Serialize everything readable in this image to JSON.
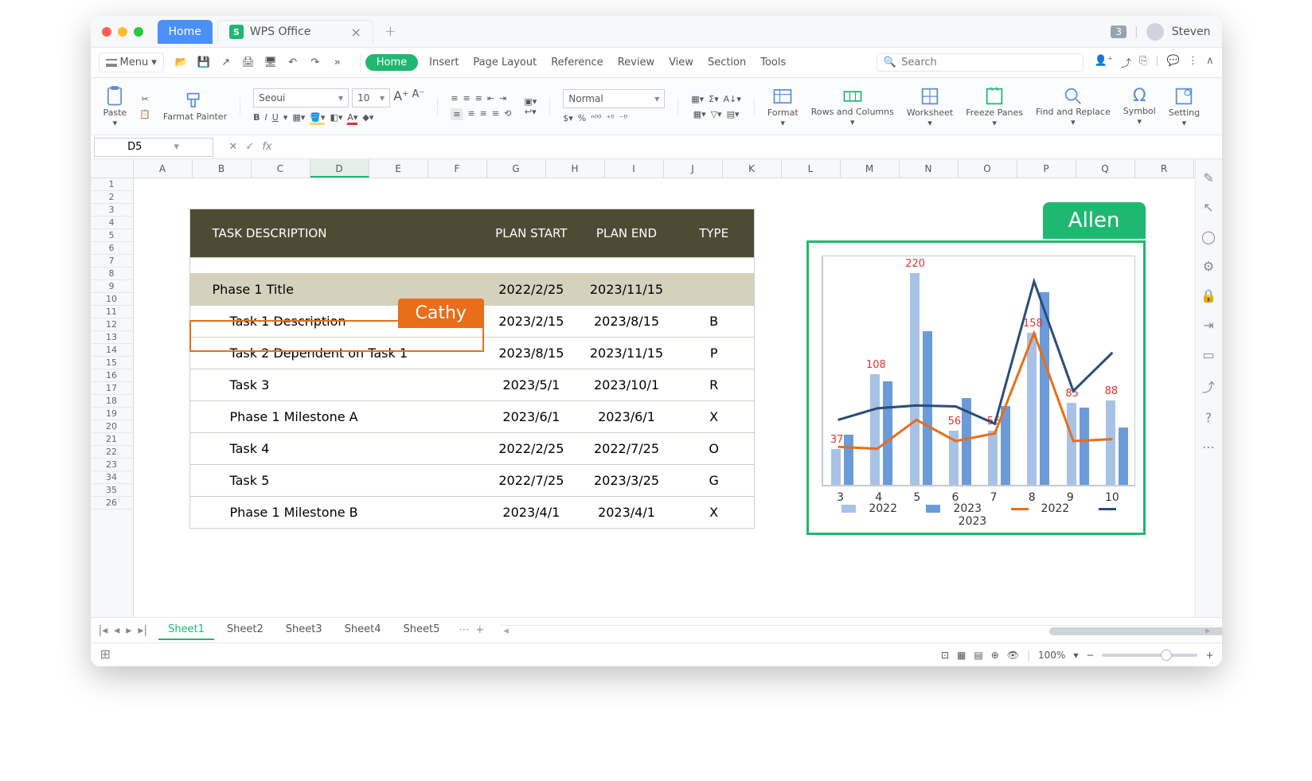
{
  "titlebar": {
    "home_tab": "Home",
    "app_tab": "WPS Office",
    "badge": "3",
    "user": "Steven"
  },
  "menubar": {
    "menu_btn": "Menu",
    "home_pill": "Home",
    "items": [
      "Insert",
      "Page Layout",
      "Reference",
      "Review",
      "View",
      "Section",
      "Tools"
    ],
    "search_placeholder": "Search"
  },
  "ribbon": {
    "paste": "Paste",
    "format_painter": "Farmat Painter",
    "font_name": "Seoui",
    "font_size": "10",
    "number_fmt": "Normal",
    "format": "Format",
    "rows_cols": "Rows and Columns",
    "worksheet": "Worksheet",
    "freeze": "Freeze Panes",
    "find_replace": "Find and Replace",
    "symbol": "Symbol",
    "setting": "Setting"
  },
  "namebox": "D5",
  "columns": [
    "A",
    "B",
    "C",
    "D",
    "E",
    "F",
    "G",
    "H",
    "I",
    "J",
    "K",
    "L",
    "M",
    "N",
    "O",
    "P",
    "Q",
    "R"
  ],
  "task_table": {
    "headers": {
      "desc": "TASK DESCRIPTION",
      "start": "PLAN START",
      "end": "PLAN END",
      "type": "TYPE"
    },
    "rows": [
      {
        "desc": "Phase 1 Title",
        "start": "2022/2/25",
        "end": "2023/11/15",
        "type": "",
        "phase": true
      },
      {
        "desc": "Task 1 Description",
        "start": "2023/2/15",
        "end": "2023/8/15",
        "type": "B"
      },
      {
        "desc": "Task 2 Dependent on Task 1",
        "start": "2023/8/15",
        "end": "2023/11/15",
        "type": "P"
      },
      {
        "desc": "Task 3",
        "start": "2023/5/1",
        "end": "2023/10/1",
        "type": "R"
      },
      {
        "desc": "Phase 1 Milestone A",
        "start": "2023/6/1",
        "end": "2023/6/1",
        "type": "X"
      },
      {
        "desc": "Task 4",
        "start": "2022/2/25",
        "end": "2022/7/25",
        "type": "O"
      },
      {
        "desc": "Task 5",
        "start": "2022/7/25",
        "end": "2023/3/25",
        "type": "G"
      },
      {
        "desc": "Phase 1 Milestone B",
        "start": "2023/4/1",
        "end": "2023/4/1",
        "type": "X"
      }
    ]
  },
  "collaborators": {
    "cathy": "Cathy",
    "allen": "Allen"
  },
  "chart_data": {
    "type": "bar+line",
    "categories": [
      "3",
      "4",
      "5",
      "6",
      "7",
      "8",
      "9",
      "10"
    ],
    "series": [
      {
        "name": "2022",
        "kind": "bar",
        "color": "#a8c2e5",
        "values": [
          37,
          115,
          220,
          56,
          56,
          158,
          85,
          88
        ]
      },
      {
        "name": "2023",
        "kind": "bar",
        "color": "#6b9bd8",
        "values": [
          52,
          108,
          160,
          90,
          82,
          200,
          80,
          60
        ]
      },
      {
        "name": "2022",
        "kind": "line",
        "color": "#e86e1a",
        "values": [
          42,
          40,
          70,
          48,
          56,
          160,
          48,
          50
        ]
      },
      {
        "name": "2023",
        "kind": "line",
        "color": "#2a4d7a",
        "values": [
          70,
          82,
          85,
          84,
          66,
          214,
          100,
          140
        ]
      }
    ],
    "data_labels": [
      37,
      108,
      220,
      56,
      56,
      158,
      85,
      88
    ],
    "ylim": [
      0,
      240
    ]
  },
  "sheets": [
    "Sheet1",
    "Sheet2",
    "Sheet3",
    "Sheet4",
    "Sheet5"
  ],
  "status": {
    "zoom": "100%"
  }
}
